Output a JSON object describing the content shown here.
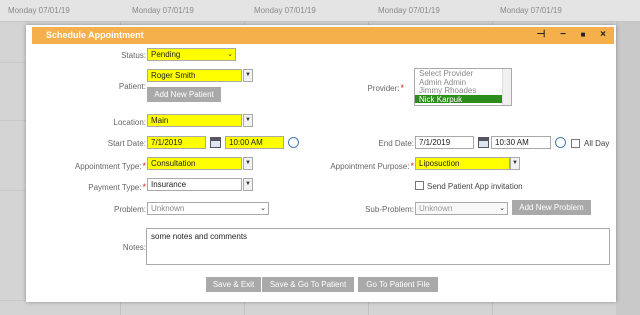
{
  "background": {
    "days": [
      "Monday 07/01/19",
      "Monday 07/01/19",
      "Monday 07/01/19",
      "Monday 07/01/19",
      "Monday 07/01/19"
    ]
  },
  "modal": {
    "title": "Schedule Appointment",
    "controls": {
      "pin": "⊣",
      "minimize": "−",
      "maximize": "■",
      "close": "×"
    },
    "accent_color": "#f6b04b",
    "highlight_color": "#ffff00"
  },
  "form": {
    "status": {
      "label": "Status:",
      "value": "Pending"
    },
    "patient": {
      "label": "Patient:",
      "value": "Roger Smith",
      "add_button": "Add New Patient"
    },
    "provider": {
      "label": "Provider:",
      "options": [
        "Select Provider",
        "Admin Admin",
        "Jimmy Rhoades",
        "Nick Karpuk"
      ],
      "selected": "Nick Karpuk"
    },
    "location": {
      "label": "Location:",
      "value": "Main"
    },
    "start_date": {
      "label": "Start Date:",
      "date": "7/1/2019",
      "time": "10:00 AM"
    },
    "end_date": {
      "label": "End Date:",
      "date": "7/1/2019",
      "time": "10:30 AM",
      "all_day": "All Day"
    },
    "appointment_type": {
      "label": "Appointment Type:",
      "value": "Consultation"
    },
    "appointment_purpose": {
      "label": "Appointment Purpose:",
      "value": "Liposuction"
    },
    "payment_type": {
      "label": "Payment Type:",
      "value": "Insurance"
    },
    "send_invitation": {
      "label": "Send Patient App invitation"
    },
    "problem": {
      "label": "Problem:",
      "value": "Unknown"
    },
    "sub_problem": {
      "label": "Sub-Problem:",
      "value": "Unknown",
      "add_button": "Add New Problem"
    },
    "notes": {
      "label": "Notes:",
      "value": "some notes and comments"
    },
    "required_mark": "*"
  },
  "actions": {
    "save_exit": "Save & Exit",
    "save_go_patient": "Save & Go To Patient",
    "go_patient_file": "Go To Patient File"
  }
}
